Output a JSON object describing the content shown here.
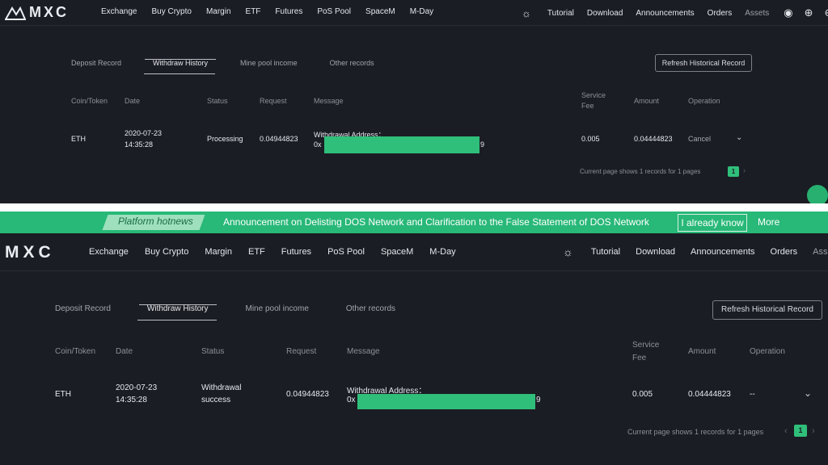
{
  "brand": {
    "logo_text": "MXC"
  },
  "nav": {
    "items": [
      "Exchange",
      "Buy Crypto",
      "Margin",
      "ETF",
      "Futures",
      "PoS Pool",
      "SpaceM",
      "M-Day"
    ],
    "right": [
      "Tutorial",
      "Download",
      "Announcements",
      "Orders",
      "Assets"
    ]
  },
  "tabs": [
    "Deposit Record",
    "Withdraw History",
    "Mine pool income",
    "Other records"
  ],
  "refresh_label": "Refresh Historical Record",
  "columns": {
    "coin": "Coin/Token",
    "date": "Date",
    "status": "Status",
    "request": "Request",
    "message": "Message",
    "fee_line1": "Service",
    "fee_line2": "Fee",
    "amount": "Amount",
    "operation": "Operation"
  },
  "top_row": {
    "coin": "ETH",
    "date_line1": "2020-07-23",
    "date_line2": "14:35:28",
    "status": "Processing",
    "request": "0.04944823",
    "message_label": "Withdrawal Address：",
    "address_prefix": "0x",
    "address_suffix": "9",
    "fee": "0.005",
    "amount": "0.04444823",
    "operation": "Cancel"
  },
  "bottom_row": {
    "coin": "ETH",
    "date_line1": "2020-07-23",
    "date_line2": "14:35:28",
    "status_line1": "Withdrawal",
    "status_line2": "success",
    "request": "0.04944823",
    "message_label": "Withdrawal Address：",
    "address_prefix": "0x",
    "address_suffix": "9",
    "fee": "0.005",
    "amount": "0.04444823",
    "operation": "--"
  },
  "pager": {
    "text": "Current page shows 1 records for 1 pages",
    "page": "1"
  },
  "banner": {
    "hot_label": "Platform hotnews",
    "announcement": "Announcement on Delisting DOS Network and Clarification to the False Statement of DOS Network",
    "know_label": "I already know",
    "more_label": "More"
  },
  "colors": {
    "accent": "#2fbf7a",
    "background": "#1b1d24",
    "banner": "#28b878"
  }
}
